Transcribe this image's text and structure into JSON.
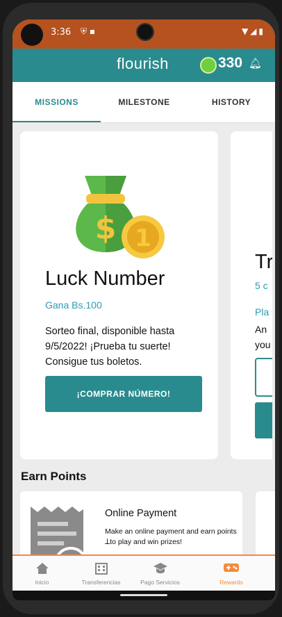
{
  "status_bar": {
    "time": "3:36",
    "left_icons": "⛨ ▪",
    "right_icons": "▼◢▮"
  },
  "header": {
    "logo": "flourish",
    "points": "330",
    "bell_icon": "bell-icon"
  },
  "tabs": [
    {
      "label": "MISSIONS",
      "active": true
    },
    {
      "label": "MILESTONE",
      "active": false
    },
    {
      "label": "HISTORY",
      "active": false
    }
  ],
  "mission_card": {
    "title": "Luck Number",
    "subtitle": "Gana Bs.100",
    "description": "Sorteo final, disponible hasta 9/5/2022! ¡Prueba tu suerte! Consigue tus boletos.",
    "button": "¡COMPRAR NÚMERO!"
  },
  "mission_card_2": {
    "title": "Tr",
    "subtitle": "5 c",
    "label": "Pla",
    "desc_line1": "An",
    "desc_line2": "you"
  },
  "earn_points": {
    "title": "Earn Points",
    "card": {
      "title": "Online Payment",
      "description": "Make an online payment and earn points 𝈜to play and win prizes!"
    }
  },
  "bottom_nav": [
    {
      "label": "Inicio",
      "icon": "home-icon",
      "active": false
    },
    {
      "label": "Transferencias",
      "icon": "building-icon",
      "active": false
    },
    {
      "label": "Pago Servicios",
      "icon": "graduation-cap-icon",
      "active": false
    },
    {
      "label": "Rewards",
      "icon": "gamepad-icon",
      "active": true
    }
  ],
  "colors": {
    "status_bar": "#b5521f",
    "brand_teal": "#2a8b8e",
    "accent_orange": "#f58a3a",
    "link_blue": "#2a9bb0"
  }
}
